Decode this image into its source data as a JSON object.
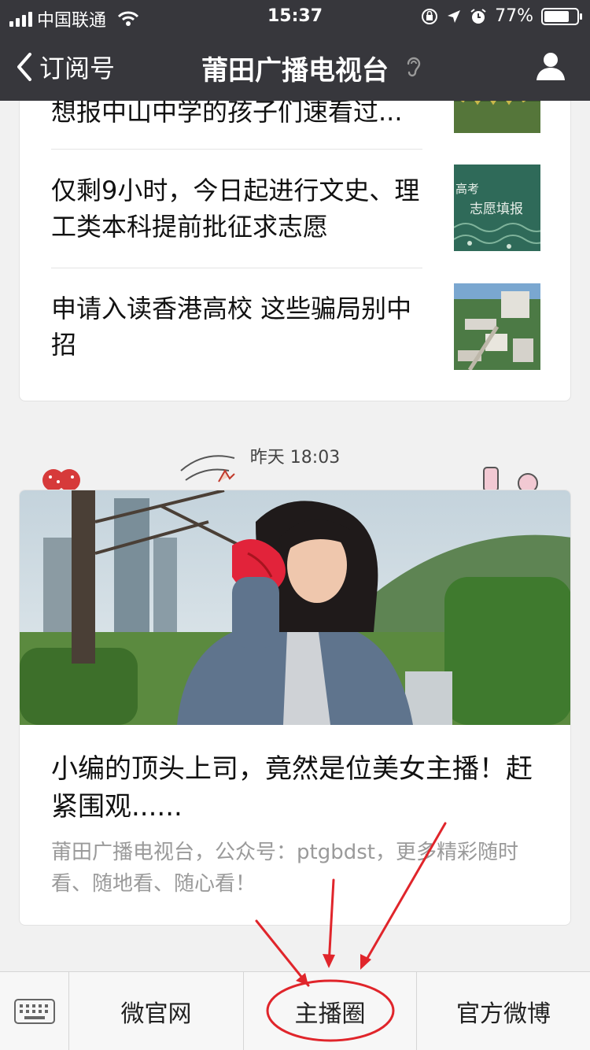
{
  "status_bar": {
    "carrier": "中国联通",
    "time": "15:37",
    "battery": "77%",
    "battery_level": 0.77
  },
  "nav": {
    "back_label": "订阅号",
    "title": "莆田广播电视台"
  },
  "articles": [
    {
      "title": "想报中山中学的孩子们速看过..."
    },
    {
      "title": "仅剩9小时，今日起进行文史、理工类本科提前批征求志愿",
      "thumb_text_a": "高考",
      "thumb_text_b": "志愿填报"
    },
    {
      "title": "申请入读香港高校 这些骗局别中招"
    }
  ],
  "timestamp": "昨天 18:03",
  "feature": {
    "headline": "小编的顶头上司，竟然是位美女主播！赶紧围观......",
    "digest": "莆田广播电视台，公众号：ptgbdst，更多精彩随时看、随地看、随心看！"
  },
  "menu": {
    "items": [
      "微官网",
      "主播圈",
      "官方微博"
    ],
    "highlighted_item": "主播圈"
  },
  "icons": {
    "status": [
      "signal-icon",
      "wifi-icon",
      "orientation-lock-icon",
      "location-icon",
      "alarm-icon",
      "battery-icon"
    ],
    "nav": [
      "back-chevron-icon",
      "ear-icon",
      "user-icon"
    ],
    "menu": [
      "keyboard-icon"
    ]
  },
  "colors": {
    "nav_bar": "#37373c",
    "annotation": "#e0252b",
    "page_bg": "#f1f1f1"
  }
}
